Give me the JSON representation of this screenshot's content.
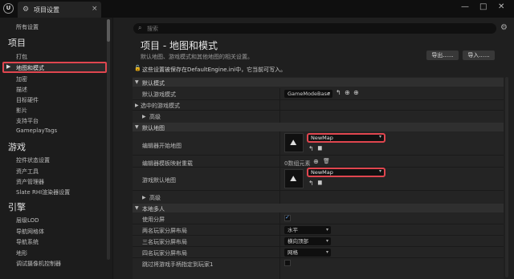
{
  "window": {
    "tab_title": "项目设置",
    "close_glyph": "×",
    "min_glyph": "—",
    "max_glyph": "□",
    "win_close_glyph": "✕",
    "logo_glyph": "U"
  },
  "sidebar": {
    "top_item": "所有设置",
    "cat_project": "项目",
    "cat_game": "游戏",
    "cat_engine": "引擎",
    "selected_arrow": "▶",
    "project_items": [
      "打包",
      "地图和模式",
      "加密",
      "描述",
      "目标硬件",
      "影片",
      "支持平台",
      "GameplayTags"
    ],
    "game_items": [
      "控件状态设置",
      "资产工具",
      "资产管理器",
      "Slate RHI渲染器设置"
    ],
    "engine_items": [
      "层级LOD",
      "导航网格体",
      "导航系统",
      "地形",
      "调试摄像机控制器"
    ]
  },
  "search": {
    "placeholder": "搜索"
  },
  "header": {
    "title": "项目 - 地图和模式",
    "description": "默认地图、游戏模式和其他地图的相关设置。",
    "export_label": "导出......",
    "import_label": "导入......",
    "lock_text": "这些设置被保存在DefaultEngine.ini中，它当前可写入。"
  },
  "sections": {
    "default_modes": {
      "title": "默认模式",
      "default_game_mode_label": "默认游戏模式",
      "default_game_mode_value": "GameModeBase",
      "selected_game_mode_label": "选中的游戏模式",
      "advanced_label": "高级"
    },
    "default_maps": {
      "title": "默认地图",
      "editor_startup_map_label": "编辑器开始地图",
      "editor_startup_map_value": "NewMap",
      "editor_template_label": "编辑器模板映射重载",
      "editor_template_value": "0数组元素",
      "game_default_map_label": "游戏默认地图",
      "game_default_map_value": "NewMap",
      "advanced_label": "高级"
    },
    "local_multiplayer": {
      "title": "本地多人",
      "use_splitscreen_label": "使用分屏",
      "two_player_label": "两名玩家分屏布局",
      "two_player_value": "水平",
      "three_player_label": "三名玩家分屏布局",
      "three_player_value": "横向顶部",
      "four_player_label": "四名玩家分屏布局",
      "four_player_value": "网格",
      "skip_controller_label": "跳过将游戏手柄指定到玩家1"
    }
  },
  "icons": {
    "arrow_glyph": "↰",
    "browse_glyph": "⊕",
    "add_glyph": "⊕",
    "folder_glyph": "▆",
    "trash_glyph": "🗑",
    "check_glyph": "✓",
    "expand_glyph": "▶",
    "collapse_glyph": "▼",
    "dropdown_glyph": "▾",
    "search_glyph": "⌕",
    "gear_glyph": "⚙",
    "lock_glyph": "🔓",
    "map_glyph": "⛰"
  }
}
